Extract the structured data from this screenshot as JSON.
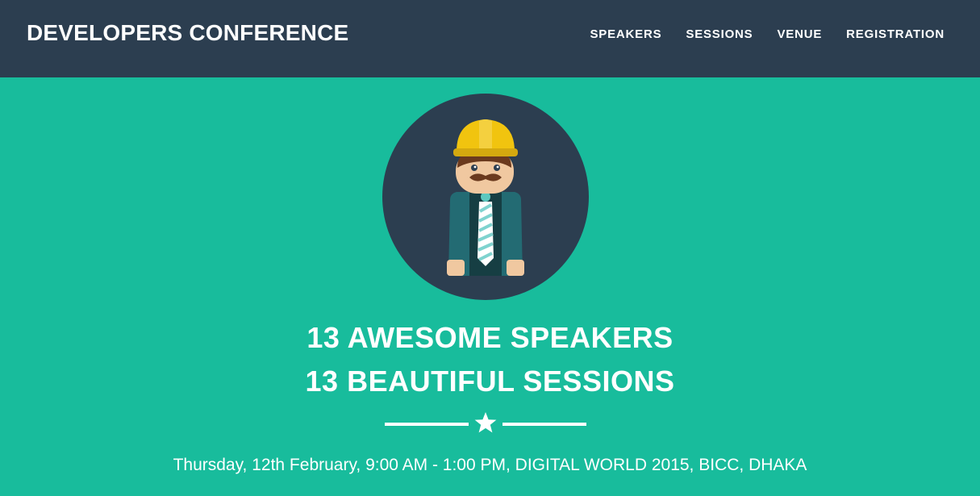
{
  "navbar": {
    "brand": "DEVELOPERS CONFERENCE",
    "links": [
      {
        "label": "SPEAKERS"
      },
      {
        "label": "SESSIONS"
      },
      {
        "label": "VENUE"
      },
      {
        "label": "REGISTRATION"
      }
    ]
  },
  "hero": {
    "avatar_icon": "builder-avatar-icon",
    "headline_1": "13 AWESOME SPEAKERS",
    "headline_2": "13 BEAUTIFUL SESSIONS",
    "divider_icon": "star-icon",
    "details": "Thursday, 12th February, 9:00 AM - 1:00 PM, DIGITAL WORLD 2015, BICC, DHAKA"
  },
  "colors": {
    "navbar_bg": "#2c3e50",
    "hero_bg": "#18bc9c",
    "text": "#ffffff"
  }
}
